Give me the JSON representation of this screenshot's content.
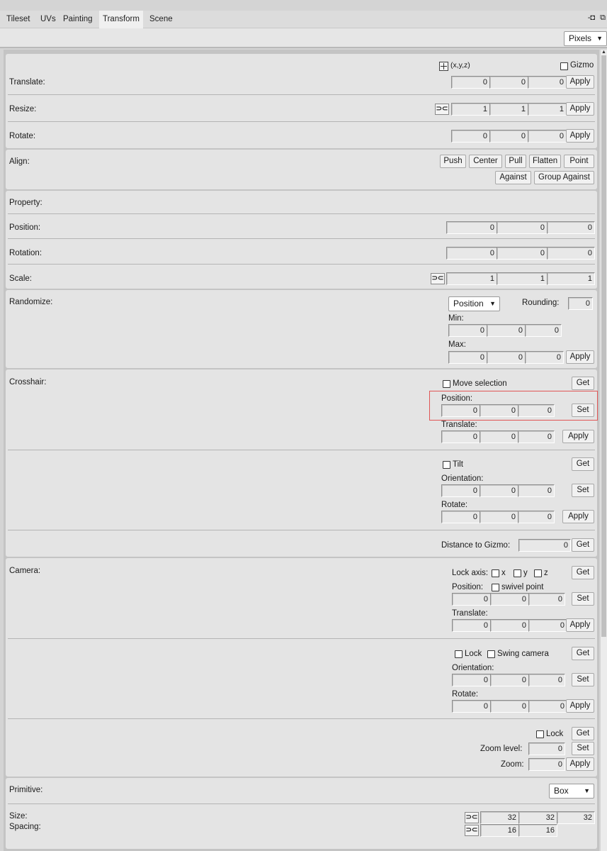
{
  "tabs": [
    "Tileset",
    "UVs",
    "Painting",
    "Transform",
    "Scene"
  ],
  "units": "Pixels",
  "translate": {
    "label": "Translate:",
    "coord_mode": "(x,y,z)",
    "gizmo": "Gizmo",
    "x": "0",
    "y": "0",
    "z": "0",
    "apply": "Apply"
  },
  "resize": {
    "label": "Resize:",
    "link": "⊃⊂",
    "x": "1",
    "y": "1",
    "z": "1",
    "apply": "Apply"
  },
  "rotate": {
    "label": "Rotate:",
    "x": "0",
    "y": "0",
    "z": "0",
    "apply": "Apply"
  },
  "align": {
    "label": "Align:",
    "buttons": [
      "Push",
      "Center",
      "Pull",
      "Flatten",
      "Point",
      "Against",
      "Group Against"
    ]
  },
  "property": {
    "label": "Property:",
    "position_label": "Position:",
    "position": [
      "0",
      "0",
      "0"
    ],
    "rotation_label": "Rotation:",
    "rotation": [
      "0",
      "0",
      "0"
    ],
    "scale_label": "Scale:",
    "scale": [
      "1",
      "1",
      "1"
    ]
  },
  "randomize": {
    "label": "Randomize:",
    "mode": "Position",
    "rounding_label": "Rounding:",
    "rounding": "0",
    "min_label": "Min:",
    "min": [
      "0",
      "0",
      "0"
    ],
    "max_label": "Max:",
    "max": [
      "0",
      "0",
      "0"
    ],
    "apply": "Apply"
  },
  "crosshair": {
    "label": "Crosshair:",
    "move_selection": "Move selection",
    "get": "Get",
    "position_label": "Position:",
    "position": [
      "0",
      "0",
      "0"
    ],
    "set": "Set",
    "translate_label": "Translate:",
    "translate": [
      "0",
      "0",
      "0"
    ],
    "apply": "Apply",
    "tilt": "Tilt",
    "orientation_label": "Orientation:",
    "orientation": [
      "0",
      "0",
      "0"
    ],
    "rotate_label": "Rotate:",
    "rotate": [
      "0",
      "0",
      "0"
    ],
    "distance_label": "Distance to Gizmo:",
    "distance": "0"
  },
  "camera": {
    "label": "Camera:",
    "lock_axis_label": "Lock axis:",
    "x": "x",
    "y": "y",
    "z": "z",
    "get": "Get",
    "position_label": "Position:",
    "swivel": "swivel point",
    "position": [
      "0",
      "0",
      "0"
    ],
    "set": "Set",
    "translate_label": "Translate:",
    "translate": [
      "0",
      "0",
      "0"
    ],
    "apply": "Apply",
    "lock": "Lock",
    "swing": "Swing camera",
    "orientation_label": "Orientation:",
    "orientation": [
      "0",
      "0",
      "0"
    ],
    "rotate_label": "Rotate:",
    "rotate": [
      "0",
      "0",
      "0"
    ],
    "zoom_level_label": "Zoom level:",
    "zoom_level": "0",
    "zoom_label": "Zoom:",
    "zoom": "0"
  },
  "primitive": {
    "label": "Primitive:",
    "shape": "Box",
    "size_label": "Size:",
    "spacing_label": "Spacing:",
    "link": "⊃⊂",
    "size": [
      "32",
      "32",
      "32"
    ],
    "spacing": [
      "16",
      "16"
    ]
  }
}
